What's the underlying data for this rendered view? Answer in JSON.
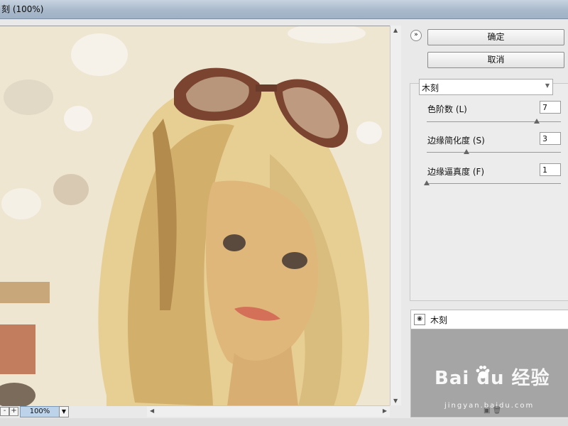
{
  "window": {
    "title": "刻 (100%)"
  },
  "preview": {
    "zoom_value": "100%",
    "zoom_minus": "-",
    "zoom_plus": "+"
  },
  "actions": {
    "ok_label": "确定",
    "cancel_label": "取消"
  },
  "filter": {
    "selected": "木刻",
    "params": [
      {
        "label": "色阶数 (L)",
        "value": "7",
        "level": 0.84
      },
      {
        "label": "边缘简化度 (S)",
        "value": "3",
        "level": 0.3
      },
      {
        "label": "边缘逼真度 (F)",
        "value": "1",
        "level": 0.0
      }
    ]
  },
  "layers": {
    "items": [
      {
        "name": "木刻"
      }
    ]
  },
  "watermark": {
    "brand": "Bai du 经验",
    "url": "jingyan.baidu.com"
  },
  "colors": {
    "titlebar": "#a9b9cb",
    "zoom_field": "#bcd3ea",
    "layer_panel": "#a5a5a5"
  }
}
